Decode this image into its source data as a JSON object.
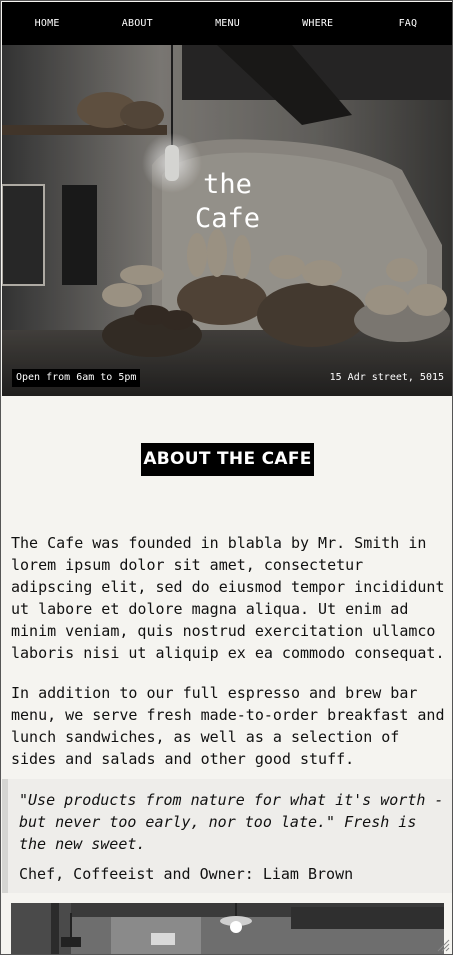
{
  "nav": {
    "items": [
      "HOME",
      "ABOUT",
      "MENU",
      "WHERE",
      "FAQ"
    ]
  },
  "hero": {
    "title_line1": "the",
    "title_line2": "Cafe",
    "hours": "Open from 6am to 5pm",
    "address": "15 Adr street, 5015"
  },
  "about": {
    "heading": "ABOUT THE CAFE",
    "paragraph1": "The Cafe was founded in blabla by Mr. Smith in lorem ipsum dolor sit amet, consectetur adipscing elit, sed do eiusmod tempor incididunt ut labore et dolore magna aliqua. Ut enim ad minim veniam, quis nostrud exercitation ullamco laboris nisi ut aliquip ex ea commodo consequat.",
    "paragraph2": "In addition to our full espresso and brew bar menu, we serve fresh made-to-order breakfast and lunch sandwiches, as well as a selection of sides and salads and other good stuff.",
    "quote": "\"Use products from nature for what it's worth - but never too early, nor too late.\" Fresh is the new sweet.",
    "quote_author": "Chef, Coffeeist and Owner: Liam Brown"
  },
  "colors": {
    "nav_bg": "#000000",
    "page_bg": "#f5f4f0",
    "quote_bg": "#eeedea",
    "quote_border": "#d5d5d2"
  }
}
